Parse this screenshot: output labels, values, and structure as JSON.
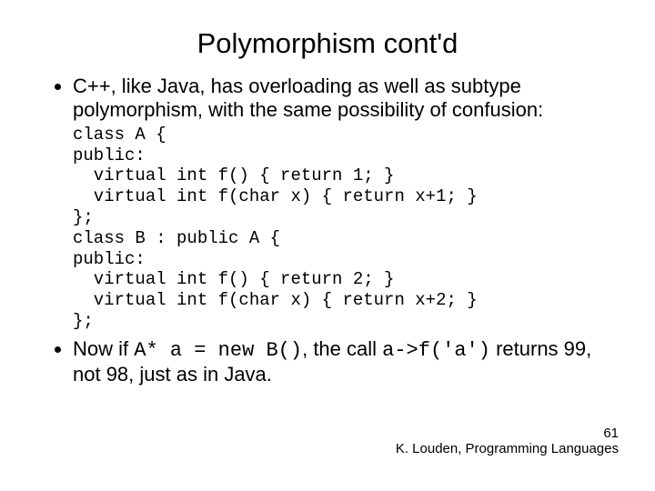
{
  "title": "Polymorphism cont'd",
  "bullet1": "C++, like Java, has overloading as well as subtype polymorphism, with the same possibility of confusion:",
  "code": {
    "l1": "class A {",
    "l2": "public:",
    "l3": "  virtual int f() { return 1; }",
    "l4": "  virtual int f(char x) { return x+1; }",
    "l5": "};",
    "l6": "class B : public A {",
    "l7": "public:",
    "l8": "  virtual int f() { return 2; }",
    "l9": "  virtual int f(char x) { return x+2; }",
    "l10": "};"
  },
  "bullet2": {
    "pre1": "Now if ",
    "code1": "A* a = new B()",
    "mid": ", the call ",
    "code2": "a->f('a')",
    "post": " returns 99, not 98, just as in Java."
  },
  "footer": {
    "page": "61",
    "attribution": "K. Louden, Programming Languages"
  }
}
